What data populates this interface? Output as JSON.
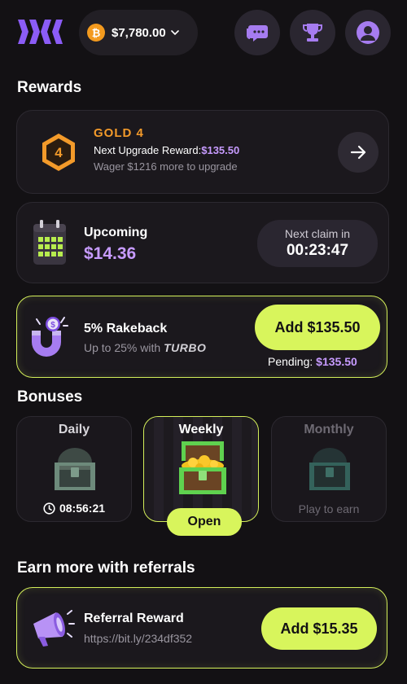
{
  "header": {
    "balance": "$7,780.00",
    "coin_symbol": "₿",
    "icons": [
      "logo-icon",
      "bitcoin-icon",
      "chevron-down-icon",
      "chat-icon",
      "trophy-icon",
      "profile-icon"
    ]
  },
  "rewards": {
    "title": "Rewards",
    "tier": {
      "badge_number": "4",
      "name": "GOLD 4",
      "next_label": "Next Upgrade Reward:",
      "next_value": "$135.50",
      "wager_text": "Wager $1216 more to upgrade"
    },
    "upcoming": {
      "label": "Upcoming",
      "amount": "$14.36",
      "next_claim_label": "Next claim in",
      "next_claim_time": "00:23:47"
    },
    "rakeback": {
      "title": "5% Rakeback",
      "subtitle_prefix": "Up to 25% with",
      "subtitle_brand": "TURBO",
      "button_label": "Add $135.50",
      "pending_label": "Pending:",
      "pending_value": "$135.50"
    }
  },
  "bonuses": {
    "title": "Bonuses",
    "items": [
      {
        "title": "Daily",
        "footer": "08:56:21"
      },
      {
        "title": "Weekly",
        "footer": "Open"
      },
      {
        "title": "Monthly",
        "footer": "Play to earn"
      }
    ]
  },
  "referrals": {
    "title": "Earn more with referrals",
    "card_title": "Referral Reward",
    "link": "https://bit.ly/234df352",
    "button_label": "Add $15.35"
  },
  "colors": {
    "background": "#131114",
    "accent_lime": "#d8f55c",
    "accent_purple": "#c79bff",
    "gold": "#f39a2a"
  }
}
